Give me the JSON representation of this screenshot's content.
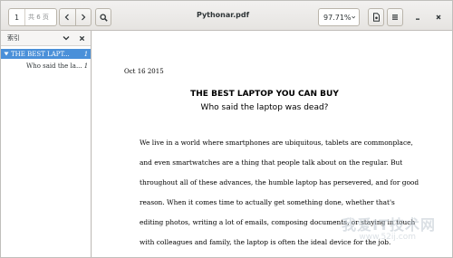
{
  "window": {
    "title": "Pythonar.pdf"
  },
  "toolbar": {
    "page_number": "1",
    "page_total": "共 6 页",
    "zoom_level": "97.71%"
  },
  "sidebar": {
    "header_label": "索引",
    "items": [
      {
        "label": "THE BEST LAPT...",
        "page": "1",
        "expanded": true,
        "selected": true
      },
      {
        "label": "Who said the la...",
        "page": "1",
        "expanded": false,
        "selected": false
      }
    ]
  },
  "document": {
    "date": "Oct 16 2015",
    "heading": "THE BEST LAPTOP YOU CAN BUY",
    "subheading": "Who said the laptop was dead?",
    "paragraph_lines": [
      "We live in a world where smartphones are ubiquitous, tablets are commonplace,",
      "and even smartwatches are a thing that people talk about on the regular. But",
      "throughout all of these advances, the humble laptop has persevered, and for good",
      "reason. When it comes time to actually get something done, whether that's",
      "editing photos, writing a lot of emails, composing documents, or staying in touch",
      "with colleagues and family, the laptop is often the ideal device for the job."
    ]
  },
  "watermark": {
    "text": "我爱IT技术网",
    "url": "www.52ij.com"
  },
  "colors": {
    "accent": "#4a90d9",
    "window_bg": "#f6f5f4",
    "border": "#c0bdb9"
  }
}
